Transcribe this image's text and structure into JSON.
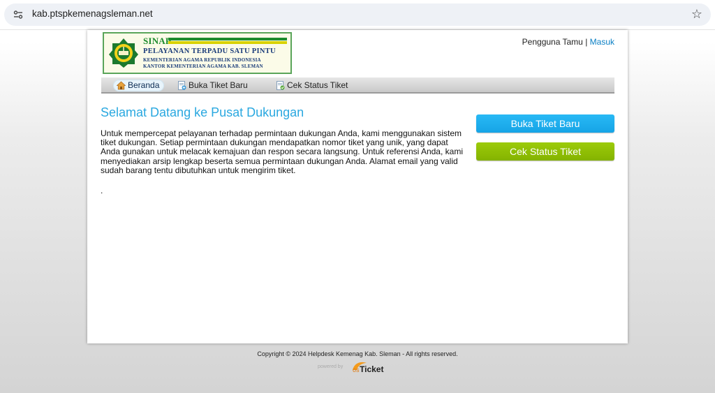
{
  "browser": {
    "url": "kab.ptspkemenagsleman.net"
  },
  "logo": {
    "sinar": "SINAR",
    "line1": "PELAYANAN TERPADU SATU PINTU",
    "line2": "KEMENTERIAN AGAMA REPUBLIK INDONESIA",
    "line3": "KANTOR KEMENTERIAN AGAMA KAB. SLEMAN"
  },
  "header": {
    "guest_user": "Pengguna Tamu",
    "separator": " | ",
    "login_link": "Masuk"
  },
  "nav": {
    "items": [
      {
        "label": "Beranda",
        "icon": "home-icon",
        "active": true
      },
      {
        "label": "Buka Tiket Baru",
        "icon": "new-ticket-icon",
        "active": false
      },
      {
        "label": "Cek Status Tiket",
        "icon": "ticket-status-icon",
        "active": false
      }
    ]
  },
  "main": {
    "title": "Selamat Datang ke Pusat Dukungan",
    "text": "Untuk mempercepat pelayanan terhadap permintaan dukungan Anda, kami menggunakan sistem tiket dukungan. Setiap permintaan dukungan mendapatkan nomor tiket yang unik, yang dapat Anda gunakan untuk melacak kemajuan dan respon secara langsung. Untuk referensi Anda, kami menyediakan arsip lengkap beserta semua permintaan dukungan Anda. Alamat email yang valid sudah barang tentu dibutuhkan untuk mengirim tiket.",
    "dot": "."
  },
  "buttons": {
    "new_ticket": "Buka Tiket Baru",
    "check_status": "Cek Status Tiket"
  },
  "footer": {
    "copyright": "Copyright © 2024 Helpdesk Kemenag Kab. Sleman - All rights reserved.",
    "powered_by": "powered by",
    "brand": "osTicket"
  },
  "colors": {
    "title_blue": "#2aa8e0",
    "new_ticket_button": "#16a4e6",
    "status_button": "#84b300",
    "link": "#0a7fc4"
  }
}
